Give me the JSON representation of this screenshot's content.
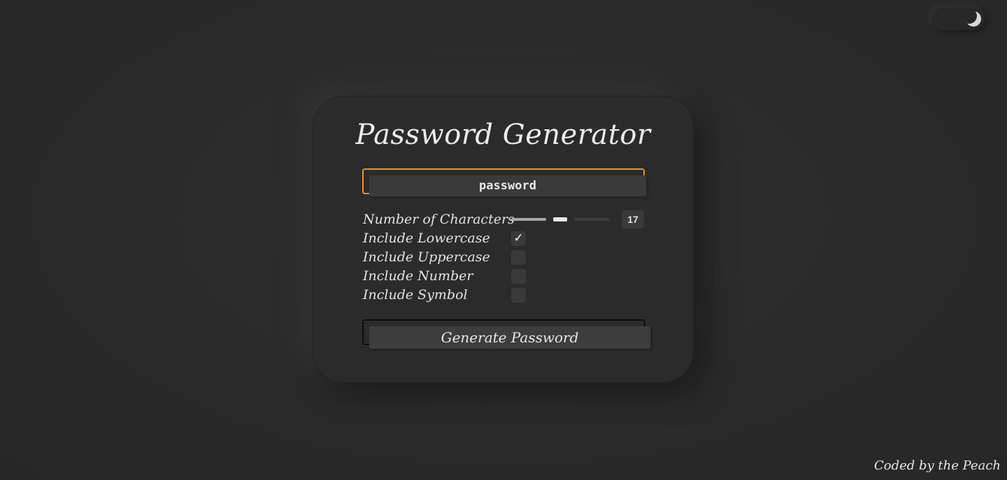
{
  "theme_toggle": {
    "icon": "moon-icon",
    "mode": "dark"
  },
  "card": {
    "title": "Password Generator",
    "password": {
      "value": "password"
    },
    "options": {
      "length": {
        "label": "Number of Characters",
        "value": "17"
      },
      "lowercase": {
        "label": "Include Lowercase",
        "checked": true,
        "check_glyph": "✓"
      },
      "uppercase": {
        "label": "Include Uppercase",
        "checked": false
      },
      "number": {
        "label": "Include Number",
        "checked": false
      },
      "symbol": {
        "label": "Include Symbol",
        "checked": false
      }
    },
    "generate_button": {
      "label": "Generate Password"
    }
  },
  "footer": {
    "credit": "Coded by the Peach"
  },
  "colors": {
    "background": "#2a2a2a",
    "card": "#2b2b2b",
    "accent_border": "#f0902a",
    "text": "#e6e6e6"
  }
}
